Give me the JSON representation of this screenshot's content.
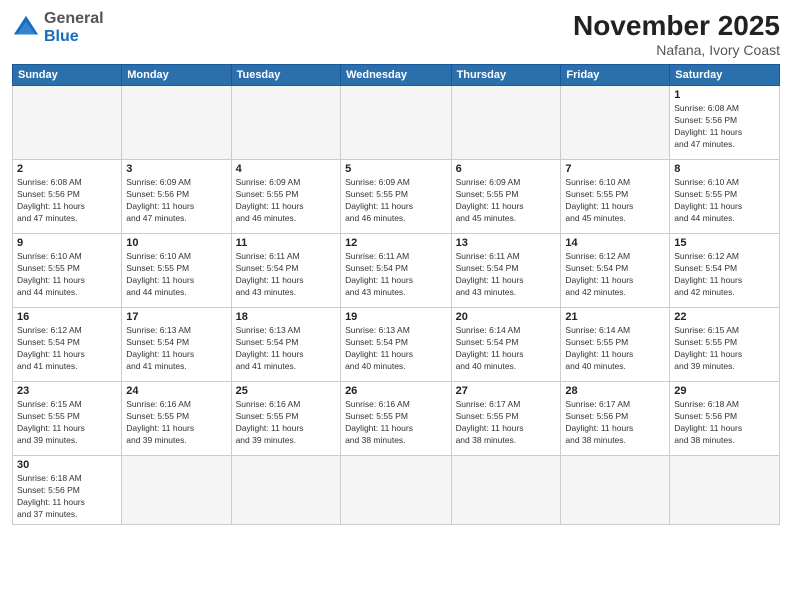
{
  "header": {
    "logo_general": "General",
    "logo_blue": "Blue",
    "month_title": "November 2025",
    "location": "Nafana, Ivory Coast"
  },
  "days_of_week": [
    "Sunday",
    "Monday",
    "Tuesday",
    "Wednesday",
    "Thursday",
    "Friday",
    "Saturday"
  ],
  "weeks": [
    [
      {
        "num": "",
        "info": ""
      },
      {
        "num": "",
        "info": ""
      },
      {
        "num": "",
        "info": ""
      },
      {
        "num": "",
        "info": ""
      },
      {
        "num": "",
        "info": ""
      },
      {
        "num": "",
        "info": ""
      },
      {
        "num": "1",
        "info": "Sunrise: 6:08 AM\nSunset: 5:56 PM\nDaylight: 11 hours\nand 47 minutes."
      }
    ],
    [
      {
        "num": "2",
        "info": "Sunrise: 6:08 AM\nSunset: 5:56 PM\nDaylight: 11 hours\nand 47 minutes."
      },
      {
        "num": "3",
        "info": "Sunrise: 6:09 AM\nSunset: 5:56 PM\nDaylight: 11 hours\nand 47 minutes."
      },
      {
        "num": "4",
        "info": "Sunrise: 6:09 AM\nSunset: 5:55 PM\nDaylight: 11 hours\nand 46 minutes."
      },
      {
        "num": "5",
        "info": "Sunrise: 6:09 AM\nSunset: 5:55 PM\nDaylight: 11 hours\nand 46 minutes."
      },
      {
        "num": "6",
        "info": "Sunrise: 6:09 AM\nSunset: 5:55 PM\nDaylight: 11 hours\nand 45 minutes."
      },
      {
        "num": "7",
        "info": "Sunrise: 6:10 AM\nSunset: 5:55 PM\nDaylight: 11 hours\nand 45 minutes."
      },
      {
        "num": "8",
        "info": "Sunrise: 6:10 AM\nSunset: 5:55 PM\nDaylight: 11 hours\nand 44 minutes."
      }
    ],
    [
      {
        "num": "9",
        "info": "Sunrise: 6:10 AM\nSunset: 5:55 PM\nDaylight: 11 hours\nand 44 minutes."
      },
      {
        "num": "10",
        "info": "Sunrise: 6:10 AM\nSunset: 5:55 PM\nDaylight: 11 hours\nand 44 minutes."
      },
      {
        "num": "11",
        "info": "Sunrise: 6:11 AM\nSunset: 5:54 PM\nDaylight: 11 hours\nand 43 minutes."
      },
      {
        "num": "12",
        "info": "Sunrise: 6:11 AM\nSunset: 5:54 PM\nDaylight: 11 hours\nand 43 minutes."
      },
      {
        "num": "13",
        "info": "Sunrise: 6:11 AM\nSunset: 5:54 PM\nDaylight: 11 hours\nand 43 minutes."
      },
      {
        "num": "14",
        "info": "Sunrise: 6:12 AM\nSunset: 5:54 PM\nDaylight: 11 hours\nand 42 minutes."
      },
      {
        "num": "15",
        "info": "Sunrise: 6:12 AM\nSunset: 5:54 PM\nDaylight: 11 hours\nand 42 minutes."
      }
    ],
    [
      {
        "num": "16",
        "info": "Sunrise: 6:12 AM\nSunset: 5:54 PM\nDaylight: 11 hours\nand 41 minutes."
      },
      {
        "num": "17",
        "info": "Sunrise: 6:13 AM\nSunset: 5:54 PM\nDaylight: 11 hours\nand 41 minutes."
      },
      {
        "num": "18",
        "info": "Sunrise: 6:13 AM\nSunset: 5:54 PM\nDaylight: 11 hours\nand 41 minutes."
      },
      {
        "num": "19",
        "info": "Sunrise: 6:13 AM\nSunset: 5:54 PM\nDaylight: 11 hours\nand 40 minutes."
      },
      {
        "num": "20",
        "info": "Sunrise: 6:14 AM\nSunset: 5:54 PM\nDaylight: 11 hours\nand 40 minutes."
      },
      {
        "num": "21",
        "info": "Sunrise: 6:14 AM\nSunset: 5:55 PM\nDaylight: 11 hours\nand 40 minutes."
      },
      {
        "num": "22",
        "info": "Sunrise: 6:15 AM\nSunset: 5:55 PM\nDaylight: 11 hours\nand 39 minutes."
      }
    ],
    [
      {
        "num": "23",
        "info": "Sunrise: 6:15 AM\nSunset: 5:55 PM\nDaylight: 11 hours\nand 39 minutes."
      },
      {
        "num": "24",
        "info": "Sunrise: 6:16 AM\nSunset: 5:55 PM\nDaylight: 11 hours\nand 39 minutes."
      },
      {
        "num": "25",
        "info": "Sunrise: 6:16 AM\nSunset: 5:55 PM\nDaylight: 11 hours\nand 39 minutes."
      },
      {
        "num": "26",
        "info": "Sunrise: 6:16 AM\nSunset: 5:55 PM\nDaylight: 11 hours\nand 38 minutes."
      },
      {
        "num": "27",
        "info": "Sunrise: 6:17 AM\nSunset: 5:55 PM\nDaylight: 11 hours\nand 38 minutes."
      },
      {
        "num": "28",
        "info": "Sunrise: 6:17 AM\nSunset: 5:56 PM\nDaylight: 11 hours\nand 38 minutes."
      },
      {
        "num": "29",
        "info": "Sunrise: 6:18 AM\nSunset: 5:56 PM\nDaylight: 11 hours\nand 38 minutes."
      }
    ],
    [
      {
        "num": "30",
        "info": "Sunrise: 6:18 AM\nSunset: 5:56 PM\nDaylight: 11 hours\nand 37 minutes."
      },
      {
        "num": "",
        "info": ""
      },
      {
        "num": "",
        "info": ""
      },
      {
        "num": "",
        "info": ""
      },
      {
        "num": "",
        "info": ""
      },
      {
        "num": "",
        "info": ""
      },
      {
        "num": "",
        "info": ""
      }
    ]
  ]
}
